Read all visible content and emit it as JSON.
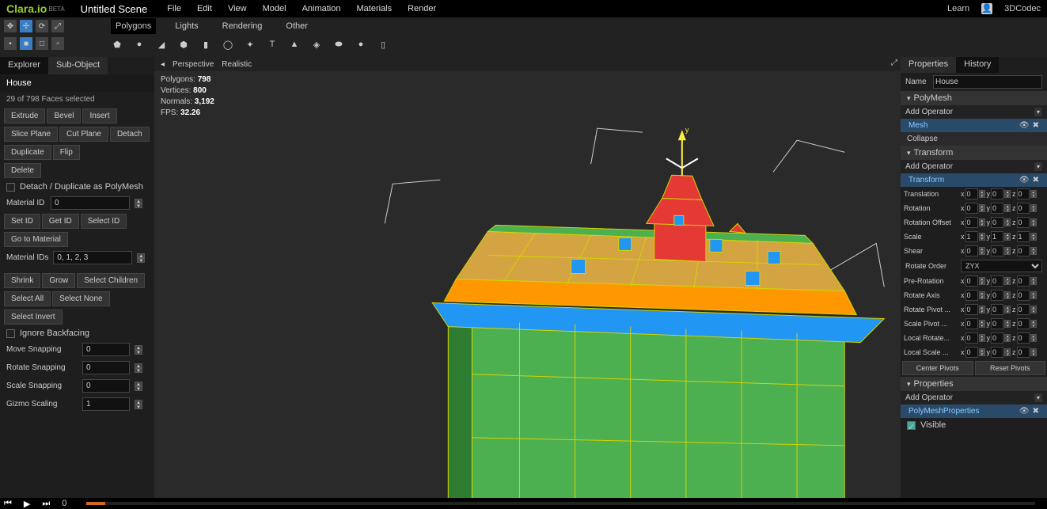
{
  "app": {
    "name": "Clara.io",
    "beta": "BETA",
    "scene": "Untitled Scene",
    "learn": "Learn",
    "user": "3DCodec"
  },
  "menu": [
    "File",
    "Edit",
    "View",
    "Model",
    "Animation",
    "Materials",
    "Render"
  ],
  "tabs": [
    "Polygons",
    "Lights",
    "Rendering",
    "Other"
  ],
  "leftTabs": {
    "explorer": "Explorer",
    "subobject": "Sub-Object"
  },
  "object": {
    "name": "House",
    "selection": "29 of 798 Faces selected"
  },
  "ops1": [
    "Extrude",
    "Bevel",
    "Insert"
  ],
  "ops2": [
    "Slice Plane",
    "Cut Plane",
    "Detach"
  ],
  "ops3": [
    "Duplicate",
    "Flip"
  ],
  "ops4": [
    "Delete"
  ],
  "detachLabel": "Detach / Duplicate as PolyMesh",
  "matId": {
    "label": "Material ID",
    "value": "0"
  },
  "idOps": [
    "Set ID",
    "Get ID",
    "Select ID"
  ],
  "goMat": "Go to Material",
  "matIds": {
    "label": "Material IDs",
    "value": "0, 1, 2, 3"
  },
  "sel1": [
    "Shrink",
    "Grow",
    "Select Children"
  ],
  "sel2": [
    "Select All",
    "Select None"
  ],
  "sel3": [
    "Select Invert"
  ],
  "ignoreBack": "Ignore Backfacing",
  "snap": [
    {
      "label": "Move Snapping",
      "value": "0"
    },
    {
      "label": "Rotate Snapping",
      "value": "0"
    },
    {
      "label": "Scale Snapping",
      "value": "0"
    },
    {
      "label": "Gizmo Scaling",
      "value": "1"
    }
  ],
  "vp": {
    "persp": "Perspective",
    "real": "Realistic"
  },
  "stats": {
    "poly": "Polygons:",
    "polyV": "798",
    "vert": "Vertices:",
    "vertV": "800",
    "norm": "Normals:",
    "normV": "3,192",
    "fps": "FPS:",
    "fpsV": "32.26"
  },
  "rightTabs": {
    "props": "Properties",
    "hist": "History"
  },
  "name": {
    "label": "Name",
    "value": "House"
  },
  "sec": {
    "poly": "PolyMesh",
    "trans": "Transform",
    "props": "Properties"
  },
  "addOp": "Add Operator",
  "mesh": "Mesh",
  "collapse": "Collapse",
  "transform": "Transform",
  "xyz": [
    {
      "lbl": "Translation",
      "x": "0",
      "y": "0",
      "z": "0"
    },
    {
      "lbl": "Rotation",
      "x": "0",
      "y": "0",
      "z": "0"
    },
    {
      "lbl": "Rotation Offset",
      "x": "0",
      "y": "0",
      "z": "0"
    },
    {
      "lbl": "Scale",
      "x": "1",
      "y": "1",
      "z": "1"
    },
    {
      "lbl": "Shear",
      "x": "0",
      "y": "0",
      "z": "0"
    }
  ],
  "rotOrder": {
    "label": "Rotate Order",
    "value": "ZYX"
  },
  "xyz2": [
    {
      "lbl": "Pre-Rotation",
      "x": "0",
      "y": "0",
      "z": "0"
    },
    {
      "lbl": "Rotate Axis",
      "x": "0",
      "y": "0",
      "z": "0"
    },
    {
      "lbl": "Rotate Pivot ...",
      "x": "0",
      "y": "0",
      "z": "0"
    },
    {
      "lbl": "Scale Pivot ...",
      "x": "0",
      "y": "0",
      "z": "0"
    },
    {
      "lbl": "Local Rotate...",
      "x": "0",
      "y": "0",
      "z": "0"
    },
    {
      "lbl": "Local Scale ...",
      "x": "0",
      "y": "0",
      "z": "0"
    }
  ],
  "pivots": {
    "center": "Center Pivots",
    "reset": "Reset Pivots"
  },
  "polyMeshProps": "PolyMeshProperties",
  "visible": "Visible",
  "timeline": {
    "frame": "0"
  }
}
